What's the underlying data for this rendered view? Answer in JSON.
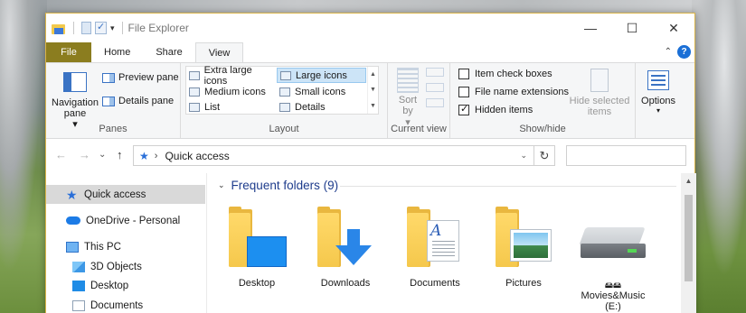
{
  "window": {
    "title": "File Explorer"
  },
  "title_bar": {
    "minimize": "—",
    "maximize": "☐",
    "close": "✕",
    "qat_dropdown": "▾"
  },
  "ribbon_tabs": [
    "File",
    "Home",
    "Share",
    "View"
  ],
  "ribbon_controls": {
    "collapse": "⌃",
    "help": "?"
  },
  "panes_group": {
    "label": "Panes",
    "navigation_pane": "Navigation pane",
    "navigation_pane_dropdown": "▾",
    "preview_pane": "Preview pane",
    "details_pane": "Details pane"
  },
  "layout_group": {
    "label": "Layout",
    "items": [
      "Extra large icons",
      "Large icons",
      "Medium icons",
      "Small icons",
      "List",
      "Details"
    ],
    "selected": "Large icons"
  },
  "current_view_group": {
    "label": "Current view",
    "sort_by": "Sort by",
    "sort_dropdown": "▾"
  },
  "show_hide_group": {
    "label": "Show/hide",
    "item_check_boxes": {
      "label": "Item check boxes",
      "checked": false
    },
    "file_name_extensions": {
      "label": "File name extensions",
      "checked": false
    },
    "hidden_items": {
      "label": "Hidden items",
      "checked": true
    },
    "hide_selected_items": "Hide selected items"
  },
  "options_group": {
    "label": "Options",
    "dropdown": "▾"
  },
  "address_bar": {
    "back": "←",
    "forward": "→",
    "recent_dropdown": "⌄",
    "up": "↑",
    "path_separator": "›",
    "path": "Quick access",
    "path_dropdown": "⌄",
    "refresh": "↻",
    "search_placeholder": ""
  },
  "sidebar": {
    "items": [
      {
        "label": "Quick access",
        "icon": "star-icon",
        "selected": true
      },
      {
        "label": "OneDrive - Personal",
        "icon": "cloud-icon"
      },
      {
        "label": "This PC",
        "icon": "pc-icon"
      },
      {
        "label": "3D Objects",
        "icon": "cube-icon"
      },
      {
        "label": "Desktop",
        "icon": "desktop-icon"
      },
      {
        "label": "Documents",
        "icon": "documents-icon"
      }
    ]
  },
  "content": {
    "section_chevron": "⌄",
    "section_title": "Frequent folders (9)",
    "folders": [
      {
        "label": "Desktop"
      },
      {
        "label": "Downloads"
      },
      {
        "label": "Documents"
      },
      {
        "label": "Pictures"
      },
      {
        "label": "Movies&Music",
        "drive_letter": "(E:)",
        "glyphs": "🖴🖴"
      }
    ]
  },
  "scrollbar": {
    "up": "▲"
  }
}
